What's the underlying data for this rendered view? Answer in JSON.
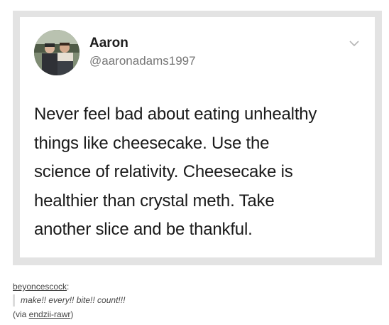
{
  "tweet": {
    "author_name": "Aaron",
    "author_handle": "@aaronadams1997",
    "avatar_icon": "profile-photo-icon",
    "menu_icon": "chevron-down-icon",
    "text_lines": [
      "Never feel bad about eating unhealthy",
      "things like cheesecake. Use the",
      "science of relativity. Cheesecake is",
      "healthier than crystal meth. Take",
      "another slice and be thankful."
    ]
  },
  "reblog": {
    "username": "beyoncescock",
    "colon": ":",
    "comment": "make!! every!! bite!! count!!!",
    "via_prefix": "(via ",
    "via_user": "endzii-rawr",
    "via_suffix": ")"
  },
  "colors": {
    "frame_gray": "#e3e3e3",
    "text_dark": "#1a1a1a",
    "handle_gray": "#767676"
  }
}
